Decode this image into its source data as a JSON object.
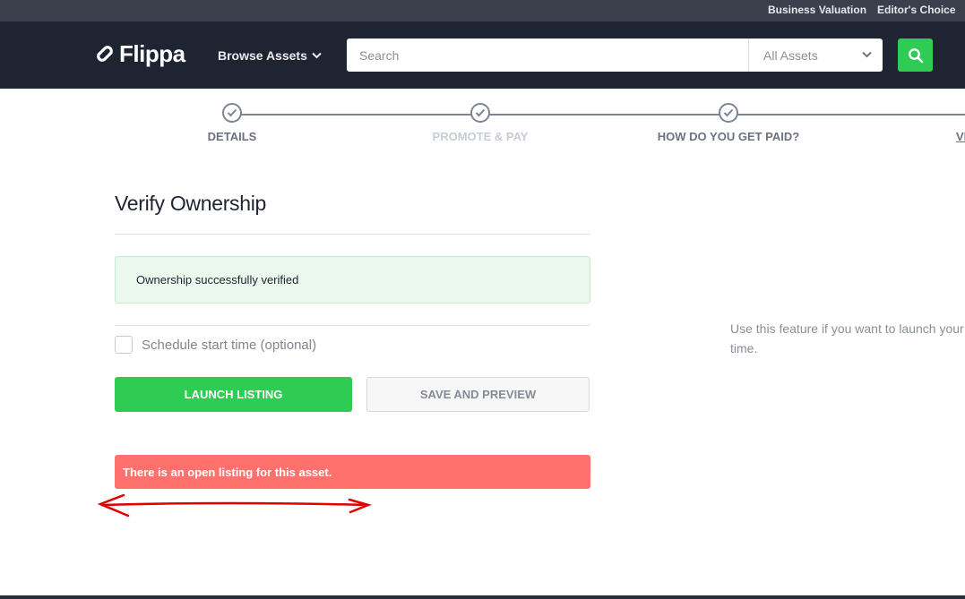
{
  "topbar": {
    "links": [
      "Business Valuation",
      "Editor's Choice"
    ]
  },
  "navbar": {
    "logo_text": "Flippa",
    "browse_label": "Browse Assets",
    "search_placeholder": "Search",
    "asset_filter": "All Assets"
  },
  "steps": [
    {
      "label": "DETAILS",
      "completed": true
    },
    {
      "label": "PROMOTE & PAY",
      "completed": true
    },
    {
      "label": "HOW DO YOU GET PAID?",
      "completed": true
    },
    {
      "label": "VE",
      "completed": false
    }
  ],
  "main": {
    "title": "Verify Ownership",
    "success_message": "Ownership successfully verified",
    "schedule_label": "Schedule start time (optional)",
    "launch_button": "LAUNCH LISTING",
    "save_button": "SAVE AND PREVIEW",
    "error_message": "There is an open listing for this asset."
  },
  "sidebar": {
    "help_line1": "Use this feature if you want to launch your",
    "help_line2": "time."
  },
  "colors": {
    "accent_green": "#2ecc53",
    "error_red": "#ff716d",
    "nav_dark": "#1f2432",
    "annotation_red": "#e00000"
  }
}
